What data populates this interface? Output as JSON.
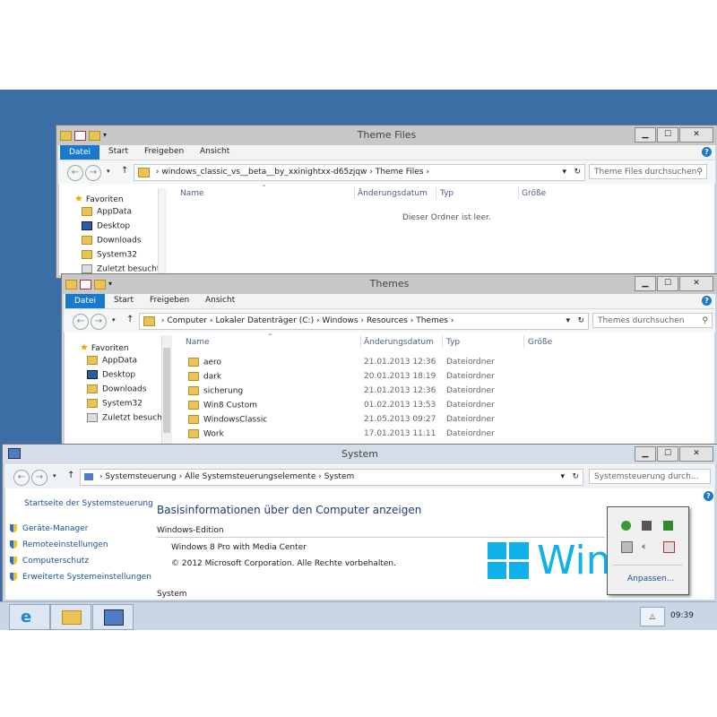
{
  "win_theme_files": {
    "title": "Theme Files",
    "ribbon": {
      "file": "Datei",
      "tabs": [
        "Start",
        "Freigeben",
        "Ansicht"
      ]
    },
    "caption": {
      "min": "▁",
      "max": "☐",
      "close": "✕"
    },
    "address": {
      "crumbs": [
        "windows_classic_vs__beta__by_xxinightxx-d65zjqw",
        "Theme Files"
      ]
    },
    "search_placeholder": "Theme Files durchsuchen",
    "columns": [
      "Name",
      "Änderungsdatum",
      "Typ",
      "Größe"
    ],
    "empty_text": "Dieser Ordner ist leer.",
    "nav": {
      "favorites": "Favoriten",
      "items": [
        "AppData",
        "Desktop",
        "Downloads",
        "System32",
        "Zuletzt besucht"
      ]
    }
  },
  "win_themes": {
    "title": "Themes",
    "ribbon": {
      "file": "Datei",
      "tabs": [
        "Start",
        "Freigeben",
        "Ansicht"
      ]
    },
    "caption": {
      "min": "▁",
      "max": "☐",
      "close": "✕"
    },
    "address": {
      "crumbs": [
        "Computer",
        "Lokaler Datenträger (C:)",
        "Windows",
        "Resources",
        "Themes"
      ]
    },
    "search_placeholder": "Themes durchsuchen",
    "columns": [
      "Name",
      "Änderungsdatum",
      "Typ",
      "Größe"
    ],
    "nav": {
      "favorites": "Favoriten",
      "items": [
        "AppData",
        "Desktop",
        "Downloads",
        "System32",
        "Zuletzt besucht"
      ]
    },
    "rows": [
      {
        "name": "aero",
        "date": "21.01.2013 12:36",
        "type": "Dateiordner"
      },
      {
        "name": "dark",
        "date": "20.01.2013 18:19",
        "type": "Dateiordner"
      },
      {
        "name": "sicherung",
        "date": "21.01.2013 12:36",
        "type": "Dateiordner"
      },
      {
        "name": "Win8 Custom",
        "date": "01.02.2013 13:53",
        "type": "Dateiordner"
      },
      {
        "name": "WindowsClassic",
        "date": "21.05.2013 09:27",
        "type": "Dateiordner"
      },
      {
        "name": "Work",
        "date": "17.01.2013 11:11",
        "type": "Dateiordner"
      }
    ]
  },
  "win_system": {
    "title": "System",
    "caption": {
      "min": "▁",
      "max": "☐",
      "close": "✕"
    },
    "address": {
      "crumbs": [
        "Systemsteuerung",
        "Alle Systemsteuerungselemente",
        "System"
      ]
    },
    "search_placeholder": "Systemsteuerung durch...",
    "sidebar": {
      "home": "Startseite der Systemsteuerung",
      "links": [
        "Geräte-Manager",
        "Remoteeinstellungen",
        "Computerschutz",
        "Erweiterte Systemeinstellungen"
      ]
    },
    "heading": "Basisinformationen über den Computer anzeigen",
    "edition_label": "Windows-Edition",
    "edition_name": "Windows 8 Pro with Media Center",
    "copyright": "© 2012 Microsoft Corporation. Alle Rechte vorbehalten.",
    "system_label": "System",
    "logo_text": "Wind"
  },
  "tray_popup": {
    "customize": "Anpassen..."
  },
  "taskbar": {
    "clock": "09:39",
    "tray_arrow": "△"
  },
  "colors": {
    "desktop": "#3a6ea5",
    "accent": "#1979ca",
    "logo": "#10b0e8"
  }
}
